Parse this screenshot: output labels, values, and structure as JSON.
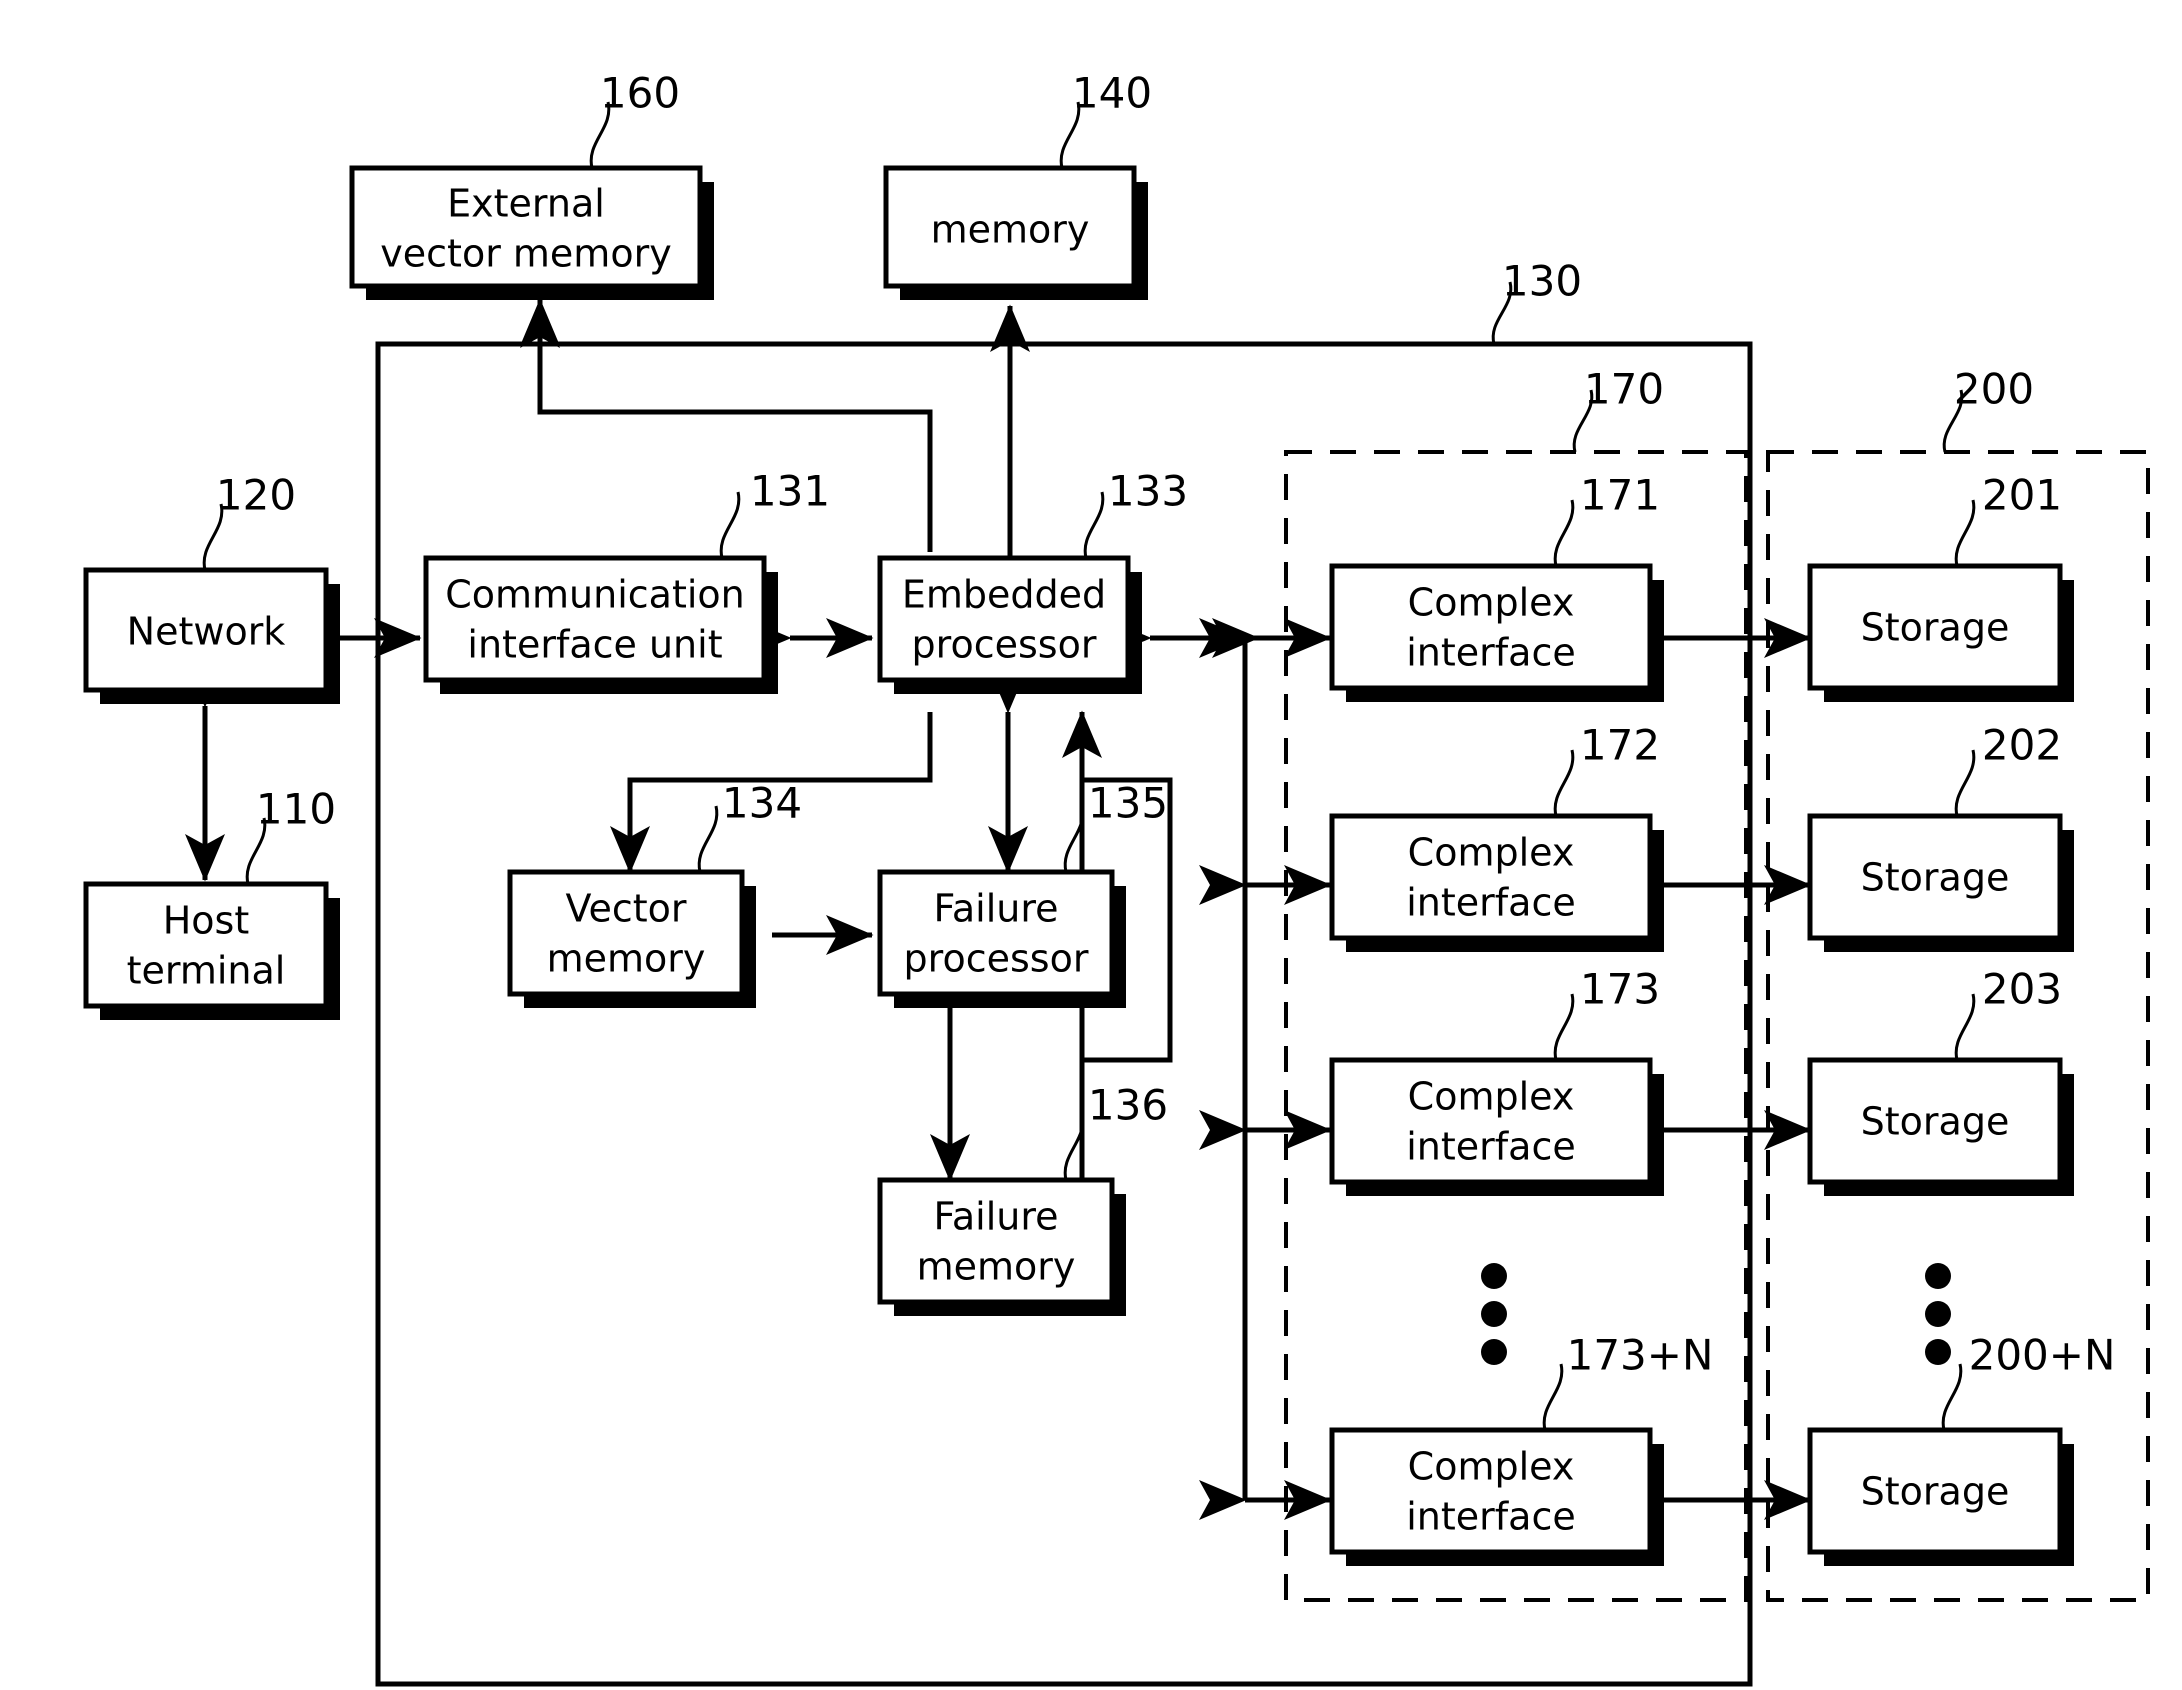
{
  "figure": {
    "type": "patent-block-diagram",
    "background": "#ffffff",
    "stroke_color": "#000000"
  },
  "blocks": [
    {
      "id": "external_vector_memory",
      "label_line1": "External",
      "label_line2": "vector memory",
      "ref": "160"
    },
    {
      "id": "memory",
      "label_line1": "memory",
      "label_line2": "",
      "ref": "140"
    },
    {
      "id": "network",
      "label_line1": "Network",
      "label_line2": "",
      "ref": "120"
    },
    {
      "id": "host_terminal",
      "label_line1": "Host",
      "label_line2": "terminal",
      "ref": "110"
    },
    {
      "id": "communication_interface_unit",
      "label_line1": "Communication",
      "label_line2": "interface unit",
      "ref": "131"
    },
    {
      "id": "embedded_processor",
      "label_line1": "Embedded",
      "label_line2": "processor",
      "ref": "133"
    },
    {
      "id": "vector_memory",
      "label_line1": "Vector",
      "label_line2": "memory",
      "ref": "134"
    },
    {
      "id": "failure_processor",
      "label_line1": "Failure",
      "label_line2": "processor",
      "ref": "135"
    },
    {
      "id": "failure_memory",
      "label_line1": "Failure",
      "label_line2": "memory",
      "ref": "136"
    },
    {
      "id": "complex_interface_1",
      "label_line1": "Complex",
      "label_line2": "interface",
      "ref": "171"
    },
    {
      "id": "complex_interface_2",
      "label_line1": "Complex",
      "label_line2": "interface",
      "ref": "172"
    },
    {
      "id": "complex_interface_3",
      "label_line1": "Complex",
      "label_line2": "interface",
      "ref": "173"
    },
    {
      "id": "complex_interface_n",
      "label_line1": "Complex",
      "label_line2": "interface",
      "ref": "173+N"
    },
    {
      "id": "storage_1",
      "label_line1": "Storage",
      "label_line2": "",
      "ref": "201"
    },
    {
      "id": "storage_2",
      "label_line1": "Storage",
      "label_line2": "",
      "ref": "202"
    },
    {
      "id": "storage_3",
      "label_line1": "Storage",
      "label_line2": "",
      "ref": "203"
    },
    {
      "id": "storage_n",
      "label_line1": "Storage",
      "label_line2": "",
      "ref": "200+N"
    }
  ],
  "groups": [
    {
      "id": "system_enclosure",
      "ref": "130",
      "style": "solid"
    },
    {
      "id": "complex_interface_group",
      "ref": "170",
      "style": "dashed"
    },
    {
      "id": "storage_group",
      "ref": "200",
      "style": "dashed"
    }
  ],
  "text": {
    "external_vector_memory_l1": "External",
    "external_vector_memory_l2": "vector memory",
    "memory": "memory",
    "network": "Network",
    "host_terminal_l1": "Host",
    "host_terminal_l2": "terminal",
    "communication_interface_unit_l1": "Communication",
    "communication_interface_unit_l2": "interface unit",
    "embedded_processor_l1": "Embedded",
    "embedded_processor_l2": "processor",
    "vector_memory_l1": "Vector",
    "vector_memory_l2": "memory",
    "failure_processor_l1": "Failure",
    "failure_processor_l2": "processor",
    "failure_memory_l1": "Failure",
    "failure_memory_l2": "memory",
    "complex_interface_l1": "Complex",
    "complex_interface_l2": "interface",
    "storage": "Storage"
  },
  "refs": {
    "r110": "110",
    "r120": "120",
    "r130": "130",
    "r131": "131",
    "r133": "133",
    "r134": "134",
    "r135": "135",
    "r136": "136",
    "r140": "140",
    "r160": "160",
    "r170": "170",
    "r171": "171",
    "r172": "172",
    "r173": "173",
    "r173N": "173+N",
    "r200": "200",
    "r201": "201",
    "r202": "202",
    "r203": "203",
    "r200N": "200+N"
  }
}
